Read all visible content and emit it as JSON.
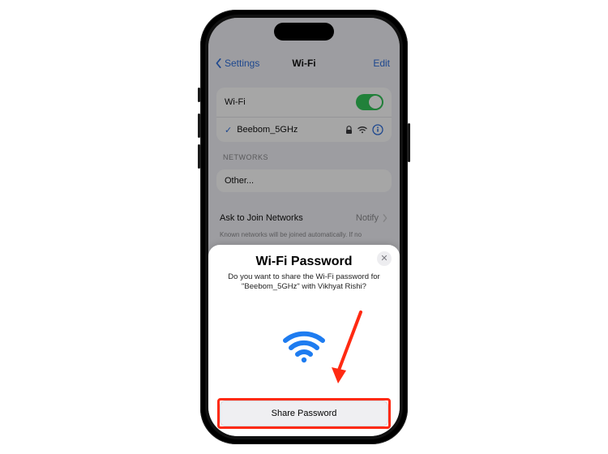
{
  "nav": {
    "back": "Settings",
    "title": "Wi-Fi",
    "edit": "Edit"
  },
  "wifi": {
    "label": "Wi-Fi",
    "network": "Beebom_5GHz"
  },
  "sections": {
    "networks": "NETWORKS",
    "other": "Other..."
  },
  "ask": {
    "label": "Ask to Join Networks",
    "value": "Notify",
    "footnote": "Known networks will be joined automatically. If no"
  },
  "sheet": {
    "title": "Wi-Fi Password",
    "message": "Do you want to share the Wi-Fi password for \"Beebom_5GHz\" with Vikhyat Rishi?",
    "button": "Share Password",
    "close": "✕"
  },
  "colors": {
    "accent": "#0a84ff",
    "toggle_on": "#34c759",
    "annotation": "#ff2a12"
  }
}
